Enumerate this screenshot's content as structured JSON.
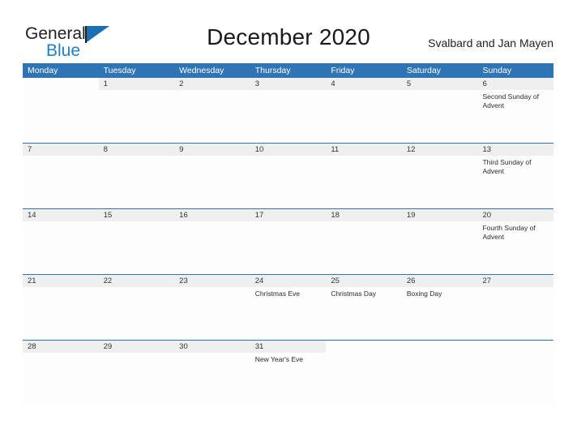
{
  "brand": {
    "line1": "General",
    "line2": "Blue",
    "flag_icon": "flag-icon"
  },
  "header": {
    "month_title": "December 2020",
    "locale_title": "Svalbard and Jan Mayen"
  },
  "calendar": {
    "day_headers": [
      "Monday",
      "Tuesday",
      "Wednesday",
      "Thursday",
      "Friday",
      "Saturday",
      "Sunday"
    ],
    "accent_color": "#2f74b5",
    "day_strip_color": "#efefef",
    "weeks": [
      [
        {
          "date": "",
          "event": ""
        },
        {
          "date": "1",
          "event": ""
        },
        {
          "date": "2",
          "event": ""
        },
        {
          "date": "3",
          "event": ""
        },
        {
          "date": "4",
          "event": ""
        },
        {
          "date": "5",
          "event": ""
        },
        {
          "date": "6",
          "event": "Second Sunday of Advent"
        }
      ],
      [
        {
          "date": "7",
          "event": ""
        },
        {
          "date": "8",
          "event": ""
        },
        {
          "date": "9",
          "event": ""
        },
        {
          "date": "10",
          "event": ""
        },
        {
          "date": "11",
          "event": ""
        },
        {
          "date": "12",
          "event": ""
        },
        {
          "date": "13",
          "event": "Third Sunday of Advent"
        }
      ],
      [
        {
          "date": "14",
          "event": ""
        },
        {
          "date": "15",
          "event": ""
        },
        {
          "date": "16",
          "event": ""
        },
        {
          "date": "17",
          "event": ""
        },
        {
          "date": "18",
          "event": ""
        },
        {
          "date": "19",
          "event": ""
        },
        {
          "date": "20",
          "event": "Fourth Sunday of Advent"
        }
      ],
      [
        {
          "date": "21",
          "event": ""
        },
        {
          "date": "22",
          "event": ""
        },
        {
          "date": "23",
          "event": ""
        },
        {
          "date": "24",
          "event": "Christmas Eve"
        },
        {
          "date": "25",
          "event": "Christmas Day"
        },
        {
          "date": "26",
          "event": "Boxing Day"
        },
        {
          "date": "27",
          "event": ""
        }
      ],
      [
        {
          "date": "28",
          "event": ""
        },
        {
          "date": "29",
          "event": ""
        },
        {
          "date": "30",
          "event": ""
        },
        {
          "date": "31",
          "event": "New Year's Eve"
        },
        {
          "date": "",
          "event": ""
        },
        {
          "date": "",
          "event": ""
        },
        {
          "date": "",
          "event": ""
        }
      ]
    ]
  }
}
